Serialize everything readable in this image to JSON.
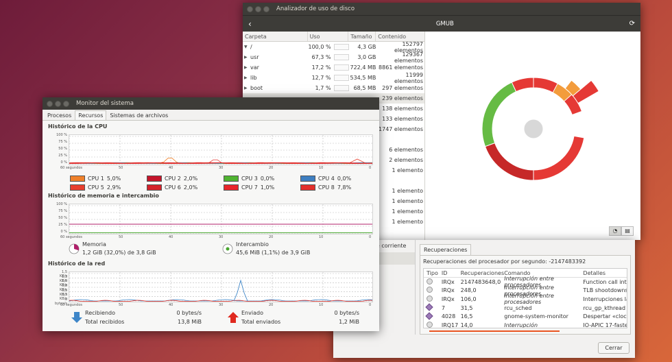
{
  "disk": {
    "title": "Analizador de uso de disco",
    "header_title": "GMUB",
    "columns": [
      "Carpeta",
      "Uso",
      "Tamaño",
      "Contenido"
    ],
    "rows": [
      {
        "name": "/",
        "expanded": true,
        "pct": "100,0 %",
        "size": "4,3 GB",
        "content": "152797 elementos"
      },
      {
        "name": "usr",
        "pct": "67,3 %",
        "size": "3,0 GB",
        "content": "129367 elementos"
      },
      {
        "name": "var",
        "pct": "17,2 %",
        "size": "722,4 MB",
        "content": "8861 elementos"
      },
      {
        "name": "lib",
        "pct": "12,7 %",
        "size": "534,5 MB",
        "content": "11999 elementos"
      },
      {
        "name": "boot",
        "pct": "1,7 %",
        "size": "68,5 MB",
        "content": "297 elementos"
      },
      {
        "name": "",
        "pct": "",
        "size": "",
        "content": "239 elementos",
        "selected": true
      },
      {
        "name": "",
        "pct": "",
        "size": "",
        "content": "138 elementos"
      },
      {
        "name": "",
        "pct": "",
        "size": "",
        "content": "133 elementos"
      },
      {
        "name": "",
        "pct": "",
        "size": "",
        "content": "1747 elementos"
      },
      {
        "name": "",
        "pct": "",
        "size": "",
        "content": ""
      },
      {
        "name": "",
        "pct": "",
        "size": "",
        "content": "6 elementos"
      },
      {
        "name": "",
        "pct": "",
        "size": "",
        "content": "2 elementos"
      },
      {
        "name": "",
        "pct": "",
        "size": "",
        "content": "1 elemento"
      },
      {
        "name": "",
        "pct": "",
        "size": "",
        "content": ""
      },
      {
        "name": "",
        "pct": "",
        "size": "",
        "content": "1 elemento"
      },
      {
        "name": "",
        "pct": "",
        "size": "",
        "content": "1 elemento"
      },
      {
        "name": "",
        "pct": "",
        "size": "",
        "content": "1 elemento"
      },
      {
        "name": "",
        "pct": "",
        "size": "",
        "content": "1 elemento"
      }
    ],
    "ring_colors": {
      "red": "#e53935",
      "dark_red": "#c62828",
      "green": "#66bb44",
      "orange": "#f39c3c",
      "center": "#d8d8d8"
    }
  },
  "procwin": {
    "left_items": [
      "r de corriente",
      "r"
    ],
    "tab": "Recuperaciones",
    "label": "Recuperaciones del procesador por segundo: -2147483392",
    "columns": [
      "Tipo",
      "ID",
      "Recuperaciones",
      "Comando",
      "Detalles"
    ],
    "rows": [
      {
        "icon": "gear",
        "id": "IRQx",
        "rec": "2147483648,0",
        "cmd": "Interrupción entre procesadores",
        "italic": true,
        "det": "Function call inte"
      },
      {
        "icon": "gear",
        "id": "IRQx",
        "rec": "248,0",
        "cmd": "Interrupción entre procesadores",
        "italic": true,
        "det": "TLB shootdowns"
      },
      {
        "icon": "gear",
        "id": "IRQx",
        "rec": "106,0",
        "cmd": "Interrupción entre procesadores",
        "italic": true,
        "det": "Interrupciones la"
      },
      {
        "icon": "diamond",
        "id": "7",
        "rec": "31,5",
        "cmd": "rcu_sched",
        "italic": false,
        "det": "rcu_gp_kthread"
      },
      {
        "icon": "diamond",
        "id": "4028",
        "rec": "16,5",
        "cmd": "gnome-system-monitor",
        "italic": false,
        "det": "Despertar «clock"
      },
      {
        "icon": "gear",
        "id": "IRQ17",
        "rec": "14,0",
        "cmd": "Interrupción",
        "italic": true,
        "det": "IO-APIC 17-faste"
      }
    ],
    "close_label": "Cerrar"
  },
  "sysmon": {
    "title": "Monitor del sistema",
    "tabs": [
      "Procesos",
      "Recursos",
      "Sistemas de archivos"
    ],
    "active_tab": 1,
    "cpu_title": "Histórico de la CPU",
    "cpu_ylabels": [
      "100 %",
      "75 %",
      "50 %",
      "25 %",
      "0 %"
    ],
    "xlabels": [
      "60 segundos",
      "50",
      "40",
      "30",
      "20",
      "10",
      "0"
    ],
    "cpus": [
      {
        "label": "CPU 1",
        "value": "5,0%",
        "color": "#f0812a"
      },
      {
        "label": "CPU 2",
        "value": "2,0%",
        "color": "#c5152b"
      },
      {
        "label": "CPU 3",
        "value": "0,0%",
        "color": "#50b432"
      },
      {
        "label": "CPU 4",
        "value": "0,0%",
        "color": "#3e7fc1"
      },
      {
        "label": "CPU 5",
        "value": "2,9%",
        "color": "#e83e2d"
      },
      {
        "label": "CPU 6",
        "value": "2,0%",
        "color": "#d5222c"
      },
      {
        "label": "CPU 7",
        "value": "1,0%",
        "color": "#e9262b"
      },
      {
        "label": "CPU 8",
        "value": "7,8%",
        "color": "#e3302b"
      }
    ],
    "mem_title": "Histórico de memoria e intercambio",
    "mem_ylabels": [
      "100 %",
      "75 %",
      "50 %",
      "25 %",
      "0 %"
    ],
    "memory_label": "Memoria",
    "memory_value": "1,2 GiB (32,0%) de 3,8 GiB",
    "swap_label": "Intercambio",
    "swap_value": "45,6 MiB (1,1%) de 3,9 GiB",
    "net_title": "Histórico de la red",
    "net_ylabels": [
      "1,5 KB/s",
      "1,3 KB/s",
      "1,0 KB/s",
      "0,8 KB/s",
      "0,5 KB/s",
      "0,3 KB/s",
      "0 bytes/s"
    ],
    "recv_label": "Recibiendo",
    "recv_value": "0 bytes/s",
    "recv_total_label": "Total recibidos",
    "recv_total_value": "13,8 MiB",
    "sent_label": "Enviado",
    "sent_value": "0 bytes/s",
    "sent_total_label": "Total enviados",
    "sent_total_value": "1,2 MiB"
  }
}
